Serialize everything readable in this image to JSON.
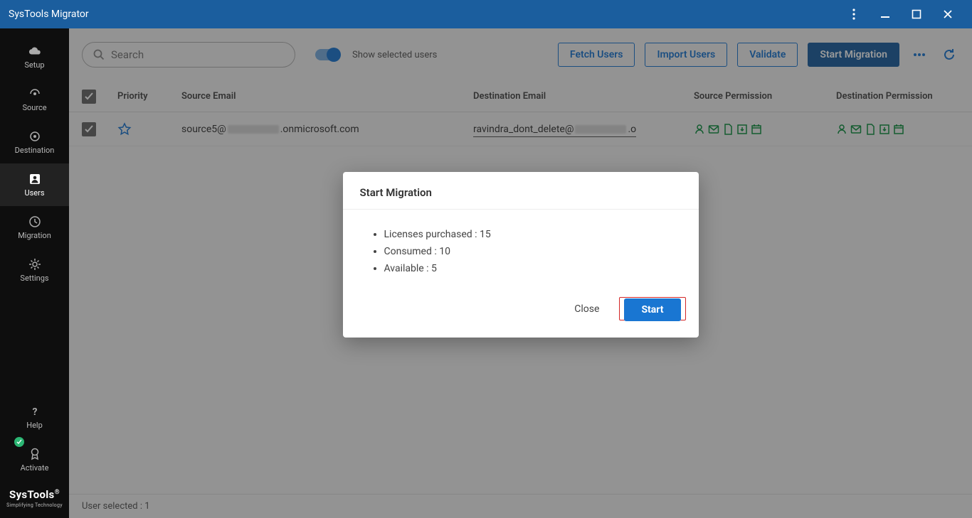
{
  "window": {
    "title": "SysTools Migrator"
  },
  "sidebar": {
    "items": [
      {
        "label": "Setup"
      },
      {
        "label": "Source"
      },
      {
        "label": "Destination"
      },
      {
        "label": "Users"
      },
      {
        "label": "Migration"
      },
      {
        "label": "Settings"
      },
      {
        "label": "Help"
      },
      {
        "label": "Activate"
      }
    ],
    "brand": "SysTools",
    "brand_sub": "Simplifying Technology"
  },
  "toolbar": {
    "search_placeholder": "Search",
    "toggle_label": "Show selected users",
    "fetch_users": "Fetch Users",
    "import_users": "Import Users",
    "validate": "Validate",
    "start_migration": "Start Migration"
  },
  "table": {
    "headers": {
      "priority": "Priority",
      "source": "Source Email",
      "destination": "Destination Email",
      "source_permission": "Source Permission",
      "destination_permission": "Destination Permission"
    },
    "rows": [
      {
        "source_prefix": "source5@",
        "source_suffix": ".onmicrosoft.com",
        "dest_prefix": "ravindra_dont_delete@",
        "dest_suffix": ".o"
      }
    ]
  },
  "statusbar": {
    "text": "User selected : 1"
  },
  "modal": {
    "title": "Start Migration",
    "licenses": "Licenses purchased : 15",
    "consumed": "Consumed : 10",
    "available": "Available : 5",
    "close": "Close",
    "start": "Start"
  }
}
